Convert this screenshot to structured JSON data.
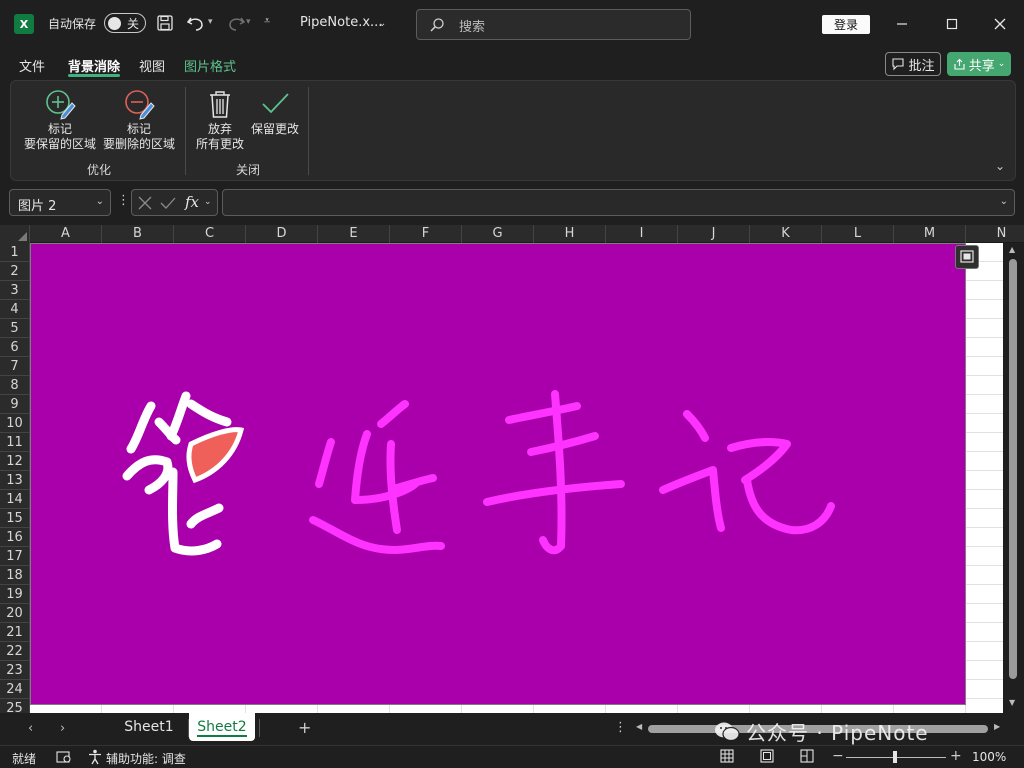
{
  "app": {
    "logo_text": "X",
    "autosave_label": "自动保存",
    "autosave_state": "关",
    "document_title": "PipeNote.x...",
    "search_placeholder": "搜索",
    "login_label": "登录",
    "brand_color": "#107c41"
  },
  "tabs": [
    {
      "label": "文件"
    },
    {
      "label": "背景消除",
      "active": true
    },
    {
      "label": "视图"
    },
    {
      "label": "图片格式",
      "contextual": true
    }
  ],
  "top_right": {
    "comments_label": "批注",
    "share_label": "共享"
  },
  "ribbon": {
    "optimize_group": "优化",
    "close_group": "关闭",
    "mark_keep": {
      "line1": "标记",
      "line2": "要保留的区域"
    },
    "mark_remove": {
      "line1": "标记",
      "line2": "要删除的区域"
    },
    "discard": {
      "line1": "放弃",
      "line2": "所有更改"
    },
    "keep_changes": "保留更改"
  },
  "formula_bar": {
    "name_box": "图片 2",
    "fx_label": "fx",
    "formula_value": ""
  },
  "grid": {
    "columns": [
      "A",
      "B",
      "C",
      "D",
      "E",
      "F",
      "G",
      "H",
      "I",
      "J",
      "K",
      "L",
      "M",
      "N"
    ],
    "rows": [
      "1",
      "2",
      "3",
      "4",
      "5",
      "6",
      "7",
      "8",
      "9",
      "10",
      "11",
      "12",
      "13",
      "14",
      "15",
      "16",
      "17",
      "18",
      "19",
      "20",
      "21",
      "22",
      "23",
      "24",
      "25"
    ],
    "picture_name": "图片 2",
    "picture_background_color": "#a900ab",
    "picture_text_color": "#ff33ff",
    "picture_calligraphy": "管道手记"
  },
  "sheets": {
    "tabs": [
      "Sheet1",
      "Sheet2"
    ],
    "active": "Sheet2"
  },
  "watermark": "公众号 · PipeNote",
  "status": {
    "ready": "就绪",
    "accessibility": "辅助功能: 调查",
    "zoom": "100%"
  }
}
